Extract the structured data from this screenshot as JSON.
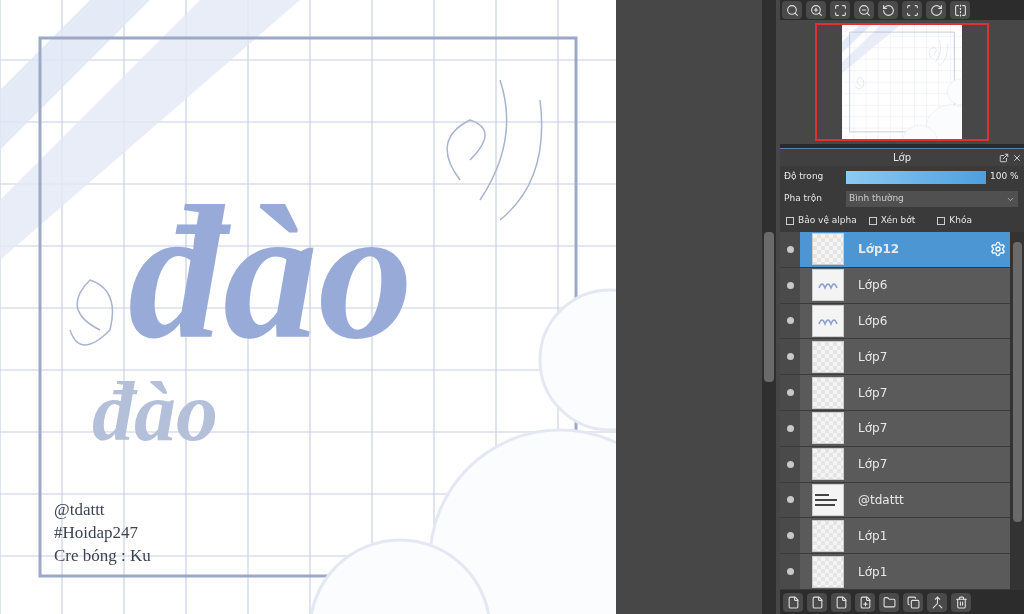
{
  "canvas": {
    "lettering": "đào",
    "faint_lettering": "đào",
    "credits": [
      "@tdattt",
      "#Hoidap247",
      "Cre bóng : Ku"
    ]
  },
  "layer_panel": {
    "title": "Lớp",
    "opacity": {
      "label": "Độ trong",
      "level": 1,
      "reading": "100 %"
    },
    "blend": {
      "label": "Pha trộn",
      "value": "Bình thường"
    },
    "options": [
      {
        "label": "Bảo vệ alpha",
        "checked": false
      },
      {
        "label": "Xén bớt",
        "checked": false
      },
      {
        "label": "Khóa",
        "checked": false
      }
    ],
    "layers": [
      {
        "name": "Lớp12",
        "selected": true,
        "kind": "blank"
      },
      {
        "name": "Lớp6",
        "selected": false,
        "kind": "lettering"
      },
      {
        "name": "Lớp6",
        "selected": false,
        "kind": "lettering"
      },
      {
        "name": "Lớp7",
        "selected": false,
        "kind": "blank"
      },
      {
        "name": "Lớp7",
        "selected": false,
        "kind": "blank"
      },
      {
        "name": "Lớp7",
        "selected": false,
        "kind": "blank"
      },
      {
        "name": "Lớp7",
        "selected": false,
        "kind": "blank"
      },
      {
        "name": "@tdattt",
        "selected": false,
        "kind": "text"
      },
      {
        "name": "Lớp1",
        "selected": false,
        "kind": "blank"
      },
      {
        "name": "Lớp1",
        "selected": false,
        "kind": "blank"
      }
    ]
  }
}
